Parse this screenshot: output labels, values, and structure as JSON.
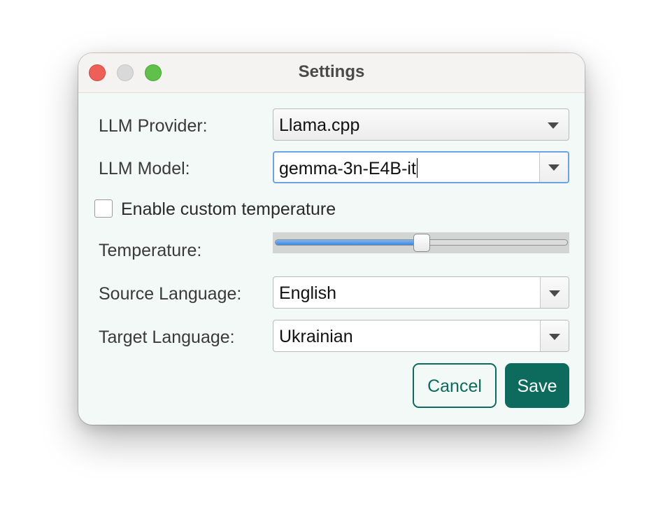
{
  "window": {
    "title": "Settings"
  },
  "form": {
    "provider_label": "LLM Provider:",
    "provider_value": "Llama.cpp",
    "model_label": "LLM Model:",
    "model_value": "gemma-3n-E4B-it",
    "custom_temp_label": "Enable custom temperature",
    "custom_temp_checked": false,
    "temperature_label": "Temperature:",
    "temperature_level": 0.5,
    "source_label": "Source Language:",
    "source_value": "English",
    "target_label": "Target Language:",
    "target_value": "Ukrainian"
  },
  "buttons": {
    "cancel": "Cancel",
    "save": "Save"
  },
  "colors": {
    "accent": "#0c6b5d",
    "focus": "#6aa3e8",
    "slider_fill": "#3f86e0",
    "window_bg": "#f3f9f7"
  },
  "icons": {
    "close": "close-icon",
    "minimize": "minimize-icon",
    "maximize": "maximize-icon",
    "dropdown": "chevron-down-icon"
  }
}
